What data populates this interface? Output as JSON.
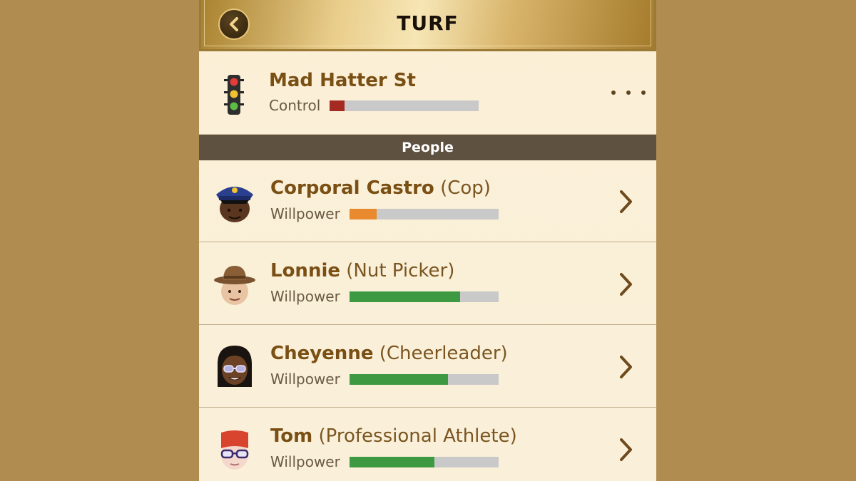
{
  "header": {
    "title": "TURF"
  },
  "location": {
    "name": "Mad Hatter St",
    "control_label": "Control",
    "control_value": 0.1,
    "control_color": "#A52A22"
  },
  "section": {
    "title": "People"
  },
  "people": [
    {
      "name": "Corporal Castro",
      "role": "(Cop)",
      "stat_label": "Willpower",
      "willpower": 0.18,
      "bar_color": "#E98A2E",
      "avatar_icon": "cop-avatar-icon"
    },
    {
      "name": "Lonnie",
      "role": "(Nut Picker)",
      "stat_label": "Willpower",
      "willpower": 0.74,
      "bar_color": "#3E9A42",
      "avatar_icon": "cowboy-avatar-icon"
    },
    {
      "name": "Cheyenne",
      "role": "(Cheerleader)",
      "stat_label": "Willpower",
      "willpower": 0.66,
      "bar_color": "#3E9A42",
      "avatar_icon": "sunglasses-avatar-icon"
    },
    {
      "name": "Tom",
      "role": "(Professional Athlete)",
      "stat_label": "Willpower",
      "willpower": 0.57,
      "bar_color": "#3E9A42",
      "avatar_icon": "athlete-avatar-icon"
    }
  ],
  "colors": {
    "background": "#B08C50",
    "name_text": "#7A4F14",
    "bar_track": "#C9C9C9",
    "section_bg": "#5E5140"
  }
}
